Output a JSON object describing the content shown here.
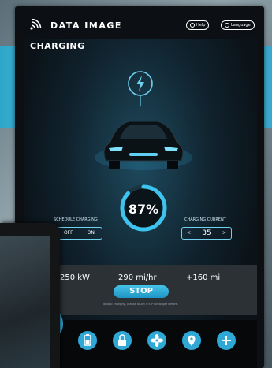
{
  "header": {
    "brand": "DATA IMAGE",
    "help_label": "Help",
    "language_label": "Language"
  },
  "page_title": "CHARGING",
  "charge": {
    "percent_text": "87%",
    "percent": 87
  },
  "schedule": {
    "label": "SCHEDULE CHARGING",
    "off": "OFF",
    "on": "ON"
  },
  "current": {
    "label": "CHARGING CURRENT",
    "value": "35",
    "dec": "<",
    "inc": ">"
  },
  "stats": {
    "power": "250 kW",
    "rate": "290 mi/hr",
    "range": "+160 mi"
  },
  "stop_label": "STOP",
  "note": "To stop charging, please touch STOP for longer before.",
  "dock": [
    "battery-icon",
    "lock-icon",
    "fan-icon",
    "location-icon",
    "plus-icon"
  ],
  "colors": {
    "accent": "#2fa8d6",
    "screen_bg": "#10222d"
  }
}
